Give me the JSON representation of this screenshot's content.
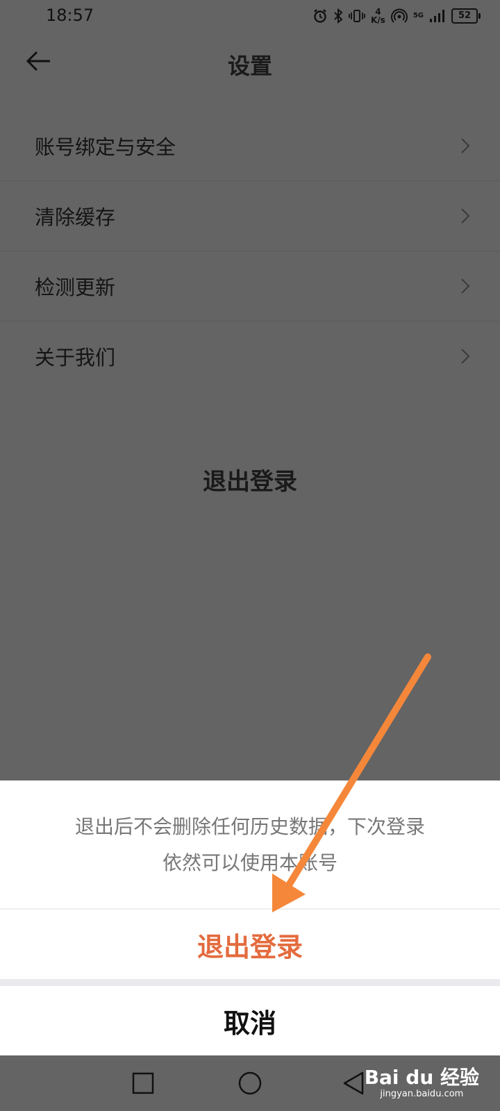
{
  "status_bar": {
    "time": "18:57",
    "net_speed_value": "4",
    "net_speed_unit": "K/s",
    "signal_badge": "5G",
    "battery": "52"
  },
  "app_bar": {
    "title": "设置",
    "back_icon": "arrow-left-icon"
  },
  "menu": {
    "items": [
      {
        "label": "账号绑定与安全",
        "icon": "chevron-right-icon"
      },
      {
        "label": "清除缓存",
        "icon": "chevron-right-icon"
      },
      {
        "label": "检测更新",
        "icon": "chevron-right-icon"
      },
      {
        "label": "关于我们",
        "icon": "chevron-right-icon"
      }
    ]
  },
  "logout_row": {
    "label": "退出登录"
  },
  "dialog": {
    "message_line1": "退出后不会删除任何历史数据，下次登录",
    "message_line2": "依然可以使用本账号",
    "confirm_label": "退出登录",
    "cancel_label": "取消",
    "confirm_color": "#e46b3e"
  },
  "nav_bar": {
    "buttons": [
      "square-recents-icon",
      "circle-home-icon",
      "triangle-back-icon"
    ]
  },
  "watermark": {
    "main": "Bai du 经验",
    "sub": "jingyan.baidu.com"
  },
  "annotation": {
    "arrow_color": "#f5873a"
  }
}
